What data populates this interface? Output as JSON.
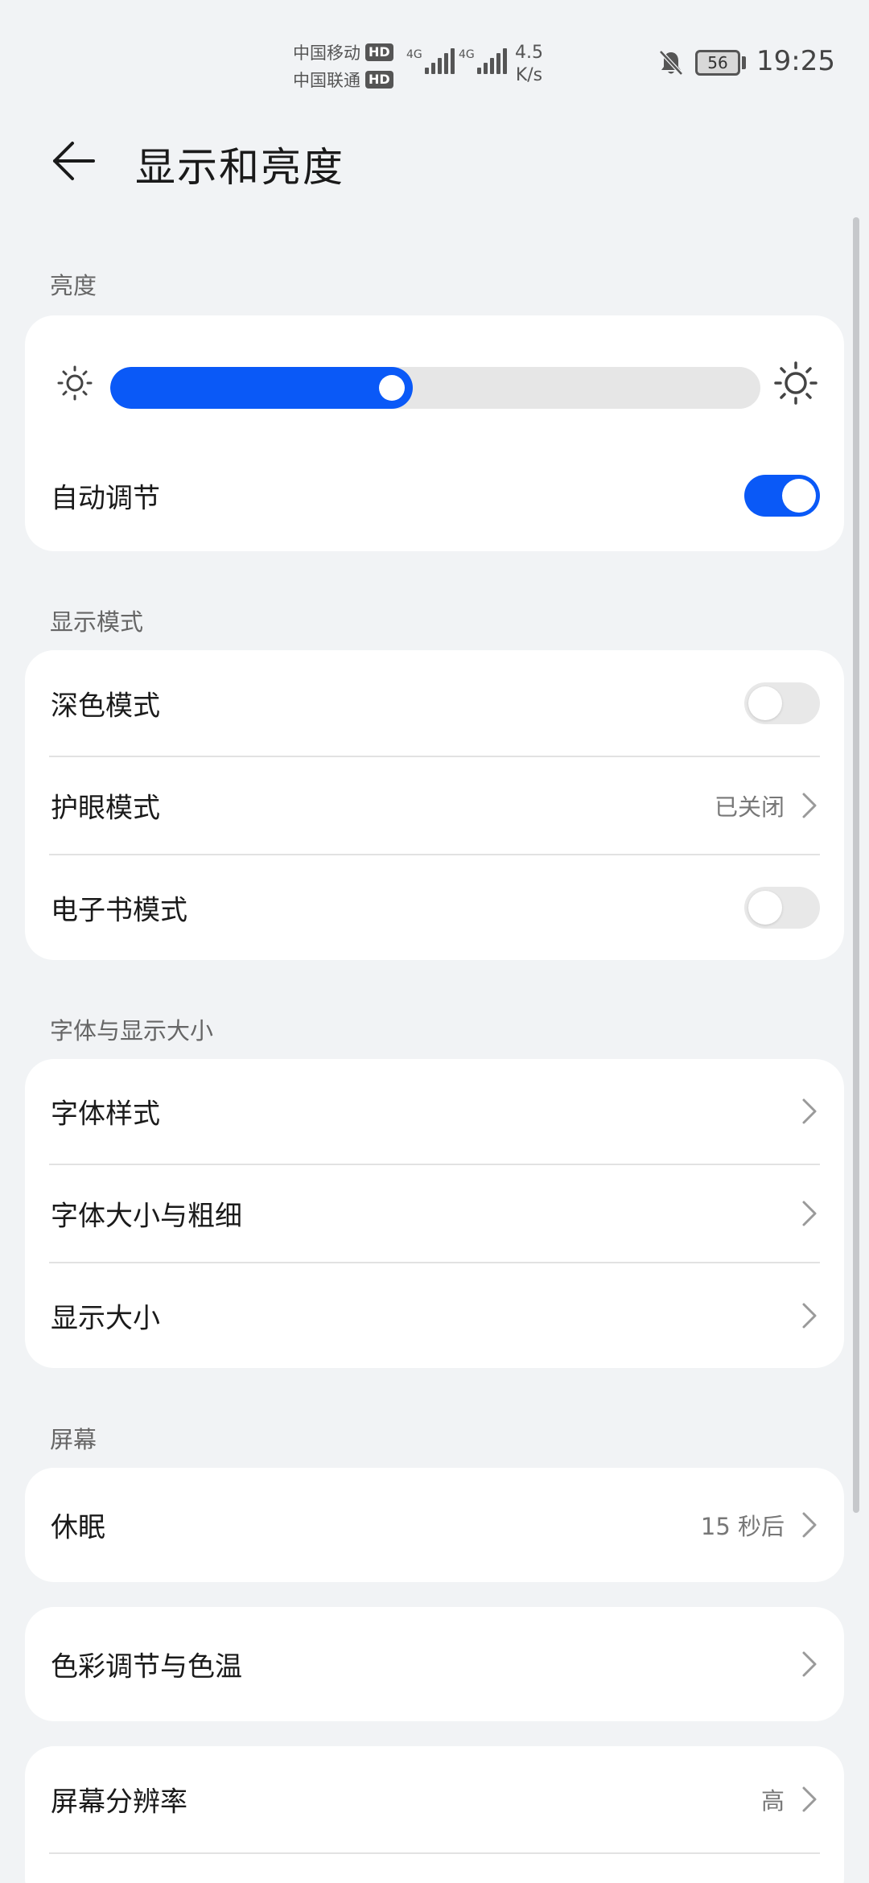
{
  "status_bar": {
    "carrier_1": "中国移动",
    "carrier_2": "中国联通",
    "hd_badge": "HD",
    "network_type": "4G",
    "net_speed_value": "4.5",
    "net_speed_unit": "K/s",
    "battery_level": "56",
    "time": "19:25",
    "icons": [
      "hd-icon",
      "signal-icon",
      "bell-off-icon",
      "battery-icon"
    ]
  },
  "header": {
    "title": "显示和亮度",
    "back_icon": "arrow-left-icon"
  },
  "brightness": {
    "section_label": "亮度",
    "slider_level": 0.465,
    "auto_adjust_label": "自动调节",
    "auto_adjust_on": true,
    "icons": [
      "sun-small-icon",
      "sun-large-icon"
    ]
  },
  "display_mode": {
    "section_label": "显示模式",
    "dark_mode_label": "深色模式",
    "dark_mode_on": false,
    "eye_comfort_label": "护眼模式",
    "eye_comfort_value": "已关闭",
    "ebook_mode_label": "电子书模式",
    "ebook_mode_on": false
  },
  "font_display": {
    "section_label": "字体与显示大小",
    "font_style_label": "字体样式",
    "font_size_weight_label": "字体大小与粗细",
    "display_size_label": "显示大小"
  },
  "screen": {
    "section_label": "屏幕",
    "sleep_label": "休眠",
    "sleep_value": "15 秒后",
    "color_temp_label": "色彩调节与色温",
    "resolution_label": "屏幕分辨率",
    "resolution_value": "高"
  },
  "colors": {
    "accent": "#0a59f7",
    "background": "#f1f3f5",
    "card": "#ffffff",
    "toggle_off": "#e8e8e8"
  }
}
